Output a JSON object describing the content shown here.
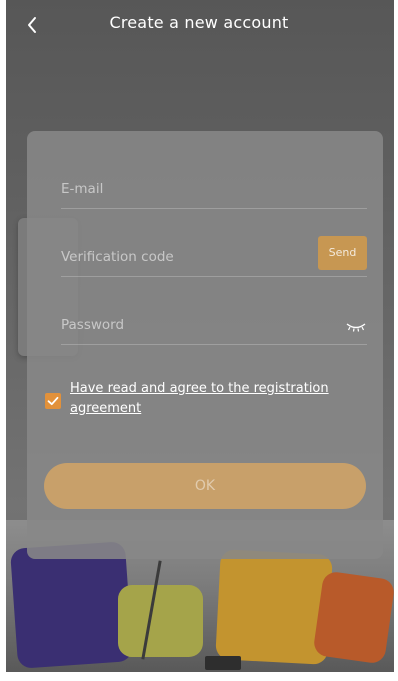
{
  "header": {
    "title": "Create a new account",
    "back_icon": "chevron-left-icon"
  },
  "form": {
    "email": {
      "placeholder": "E-mail",
      "value": ""
    },
    "verification_code": {
      "placeholder": "Verification code",
      "value": ""
    },
    "send_label": "Send",
    "password": {
      "placeholder": "Password",
      "value": "",
      "visibility_icon": "eye-closed-icon"
    },
    "agreement": {
      "checked": true,
      "label": "Have read and agree to the registration agreement"
    },
    "ok_label": "OK"
  },
  "colors": {
    "accent": "#e2913a",
    "ok_button": "#c8a06a",
    "send_button": "#c79752"
  }
}
